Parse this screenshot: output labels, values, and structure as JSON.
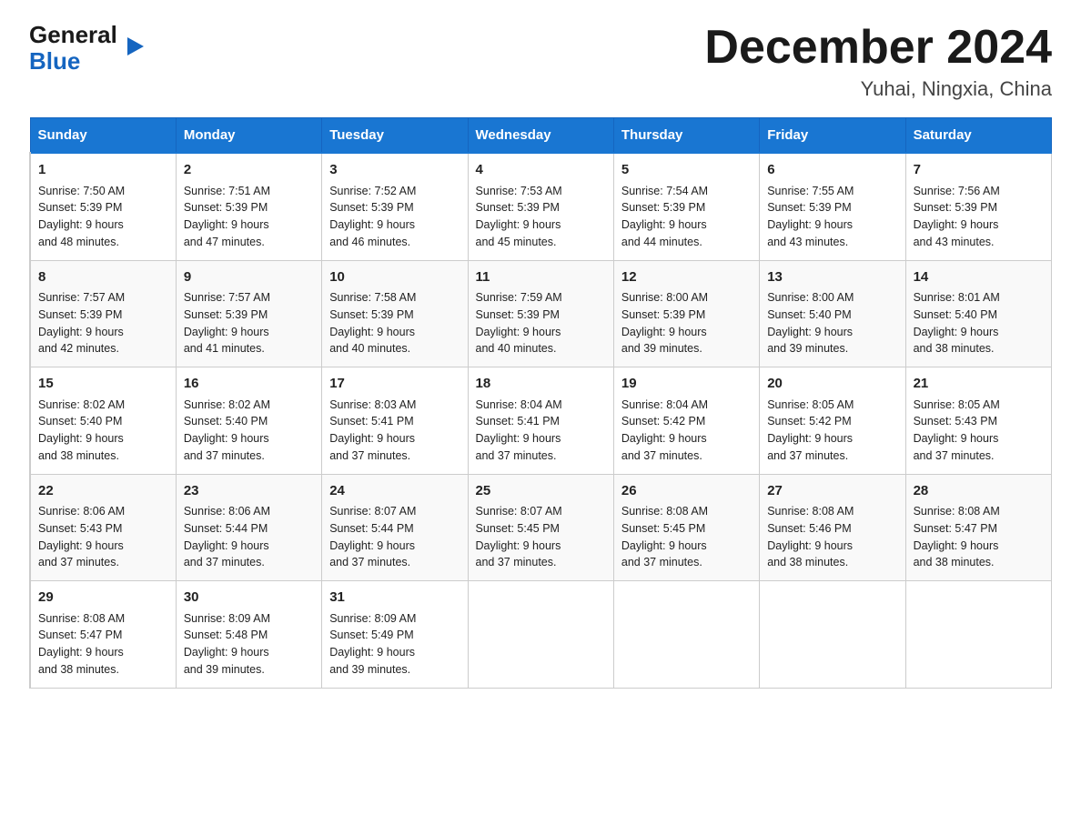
{
  "logo": {
    "line1": "General",
    "triangle": "▶",
    "line2": "Blue"
  },
  "title": "December 2024",
  "subtitle": "Yuhai, Ningxia, China",
  "days": [
    "Sunday",
    "Monday",
    "Tuesday",
    "Wednesday",
    "Thursday",
    "Friday",
    "Saturday"
  ],
  "weeks": [
    [
      {
        "num": "1",
        "sunrise": "7:50 AM",
        "sunset": "5:39 PM",
        "daylight": "9 hours and 48 minutes."
      },
      {
        "num": "2",
        "sunrise": "7:51 AM",
        "sunset": "5:39 PM",
        "daylight": "9 hours and 47 minutes."
      },
      {
        "num": "3",
        "sunrise": "7:52 AM",
        "sunset": "5:39 PM",
        "daylight": "9 hours and 46 minutes."
      },
      {
        "num": "4",
        "sunrise": "7:53 AM",
        "sunset": "5:39 PM",
        "daylight": "9 hours and 45 minutes."
      },
      {
        "num": "5",
        "sunrise": "7:54 AM",
        "sunset": "5:39 PM",
        "daylight": "9 hours and 44 minutes."
      },
      {
        "num": "6",
        "sunrise": "7:55 AM",
        "sunset": "5:39 PM",
        "daylight": "9 hours and 43 minutes."
      },
      {
        "num": "7",
        "sunrise": "7:56 AM",
        "sunset": "5:39 PM",
        "daylight": "9 hours and 43 minutes."
      }
    ],
    [
      {
        "num": "8",
        "sunrise": "7:57 AM",
        "sunset": "5:39 PM",
        "daylight": "9 hours and 42 minutes."
      },
      {
        "num": "9",
        "sunrise": "7:57 AM",
        "sunset": "5:39 PM",
        "daylight": "9 hours and 41 minutes."
      },
      {
        "num": "10",
        "sunrise": "7:58 AM",
        "sunset": "5:39 PM",
        "daylight": "9 hours and 40 minutes."
      },
      {
        "num": "11",
        "sunrise": "7:59 AM",
        "sunset": "5:39 PM",
        "daylight": "9 hours and 40 minutes."
      },
      {
        "num": "12",
        "sunrise": "8:00 AM",
        "sunset": "5:39 PM",
        "daylight": "9 hours and 39 minutes."
      },
      {
        "num": "13",
        "sunrise": "8:00 AM",
        "sunset": "5:40 PM",
        "daylight": "9 hours and 39 minutes."
      },
      {
        "num": "14",
        "sunrise": "8:01 AM",
        "sunset": "5:40 PM",
        "daylight": "9 hours and 38 minutes."
      }
    ],
    [
      {
        "num": "15",
        "sunrise": "8:02 AM",
        "sunset": "5:40 PM",
        "daylight": "9 hours and 38 minutes."
      },
      {
        "num": "16",
        "sunrise": "8:02 AM",
        "sunset": "5:40 PM",
        "daylight": "9 hours and 37 minutes."
      },
      {
        "num": "17",
        "sunrise": "8:03 AM",
        "sunset": "5:41 PM",
        "daylight": "9 hours and 37 minutes."
      },
      {
        "num": "18",
        "sunrise": "8:04 AM",
        "sunset": "5:41 PM",
        "daylight": "9 hours and 37 minutes."
      },
      {
        "num": "19",
        "sunrise": "8:04 AM",
        "sunset": "5:42 PM",
        "daylight": "9 hours and 37 minutes."
      },
      {
        "num": "20",
        "sunrise": "8:05 AM",
        "sunset": "5:42 PM",
        "daylight": "9 hours and 37 minutes."
      },
      {
        "num": "21",
        "sunrise": "8:05 AM",
        "sunset": "5:43 PM",
        "daylight": "9 hours and 37 minutes."
      }
    ],
    [
      {
        "num": "22",
        "sunrise": "8:06 AM",
        "sunset": "5:43 PM",
        "daylight": "9 hours and 37 minutes."
      },
      {
        "num": "23",
        "sunrise": "8:06 AM",
        "sunset": "5:44 PM",
        "daylight": "9 hours and 37 minutes."
      },
      {
        "num": "24",
        "sunrise": "8:07 AM",
        "sunset": "5:44 PM",
        "daylight": "9 hours and 37 minutes."
      },
      {
        "num": "25",
        "sunrise": "8:07 AM",
        "sunset": "5:45 PM",
        "daylight": "9 hours and 37 minutes."
      },
      {
        "num": "26",
        "sunrise": "8:08 AM",
        "sunset": "5:45 PM",
        "daylight": "9 hours and 37 minutes."
      },
      {
        "num": "27",
        "sunrise": "8:08 AM",
        "sunset": "5:46 PM",
        "daylight": "9 hours and 38 minutes."
      },
      {
        "num": "28",
        "sunrise": "8:08 AM",
        "sunset": "5:47 PM",
        "daylight": "9 hours and 38 minutes."
      }
    ],
    [
      {
        "num": "29",
        "sunrise": "8:08 AM",
        "sunset": "5:47 PM",
        "daylight": "9 hours and 38 minutes."
      },
      {
        "num": "30",
        "sunrise": "8:09 AM",
        "sunset": "5:48 PM",
        "daylight": "9 hours and 39 minutes."
      },
      {
        "num": "31",
        "sunrise": "8:09 AM",
        "sunset": "5:49 PM",
        "daylight": "9 hours and 39 minutes."
      },
      null,
      null,
      null,
      null
    ]
  ]
}
